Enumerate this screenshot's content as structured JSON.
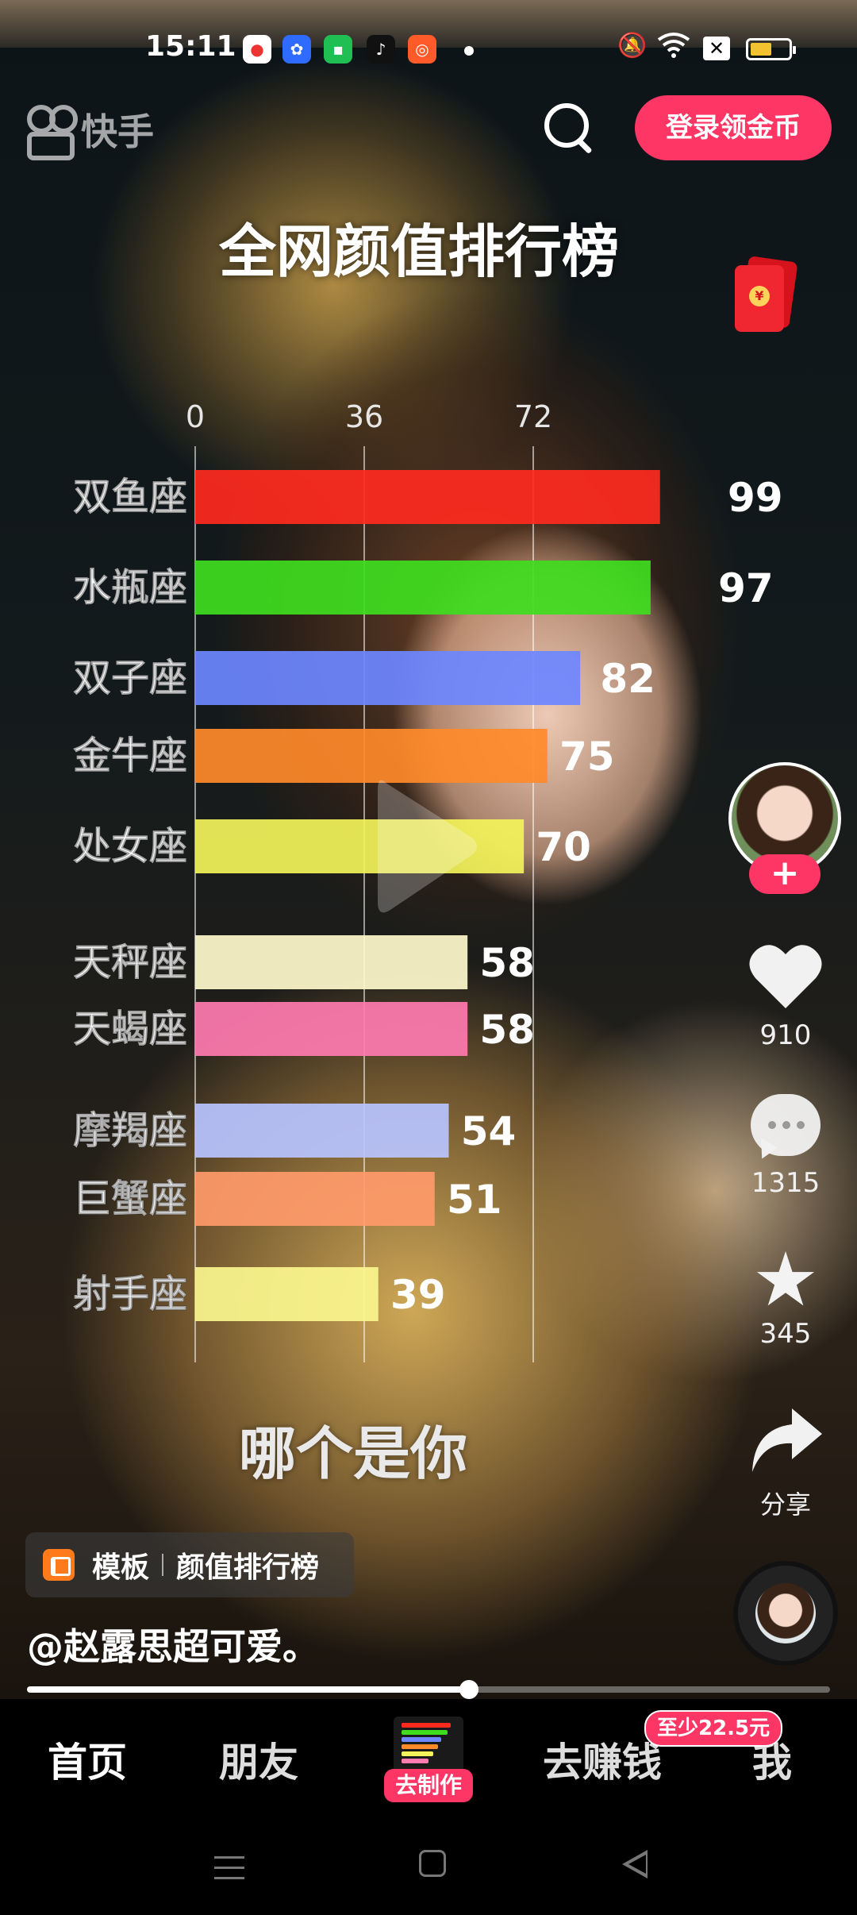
{
  "status_bar": {
    "time": "15:11",
    "notification_icons": [
      "browser-icon",
      "baidu-icon",
      "wechat-mini-icon",
      "tiktok-icon",
      "kuaishou-icon"
    ],
    "system_icons": [
      "mute-icon",
      "wifi-icon",
      "close-box-icon",
      "battery-icon"
    ],
    "battery_level": 0.5
  },
  "top_bar": {
    "logo_text": "快手",
    "search_icon": "search-icon",
    "login_button": "登录领金币"
  },
  "red_packet": {
    "icon": "red-envelope-icon",
    "symbol": "¥"
  },
  "video_caption": "哪个是你",
  "chart_data": {
    "type": "bar",
    "orientation": "horizontal",
    "title": "全网颜值排行榜",
    "categories": [
      "双鱼座",
      "水瓶座",
      "双子座",
      "金牛座",
      "处女座",
      "天秤座",
      "天蝎座",
      "摩羯座",
      "巨蟹座",
      "射手座"
    ],
    "values": [
      99,
      97,
      82,
      75,
      70,
      58,
      58,
      54,
      51,
      39
    ],
    "colors": [
      "#ff2a1e",
      "#3fdd1e",
      "#6d87ff",
      "#ff8a2a",
      "#f3f35a",
      "#fffacc",
      "#ff7bb0",
      "#b8c4ff",
      "#ff9a6a",
      "#fbf68e"
    ],
    "x_ticks": [
      "0",
      "36",
      "72"
    ],
    "xlim": [
      0,
      108
    ],
    "grid": true
  },
  "side_rail": {
    "avatar": "creator-avatar",
    "follow": "+",
    "likes": "910",
    "comments": "1315",
    "favorites": "345",
    "share": "分享"
  },
  "template": {
    "label": "模板",
    "name": "颜值排行榜"
  },
  "author": "@赵露思超可爱。",
  "playback_progress": 0.55,
  "bottom_nav": {
    "home": "首页",
    "friends": "朋友",
    "create": "去制作",
    "earn": "去赚钱",
    "earn_badge": "至少22.5元",
    "me": "我"
  }
}
